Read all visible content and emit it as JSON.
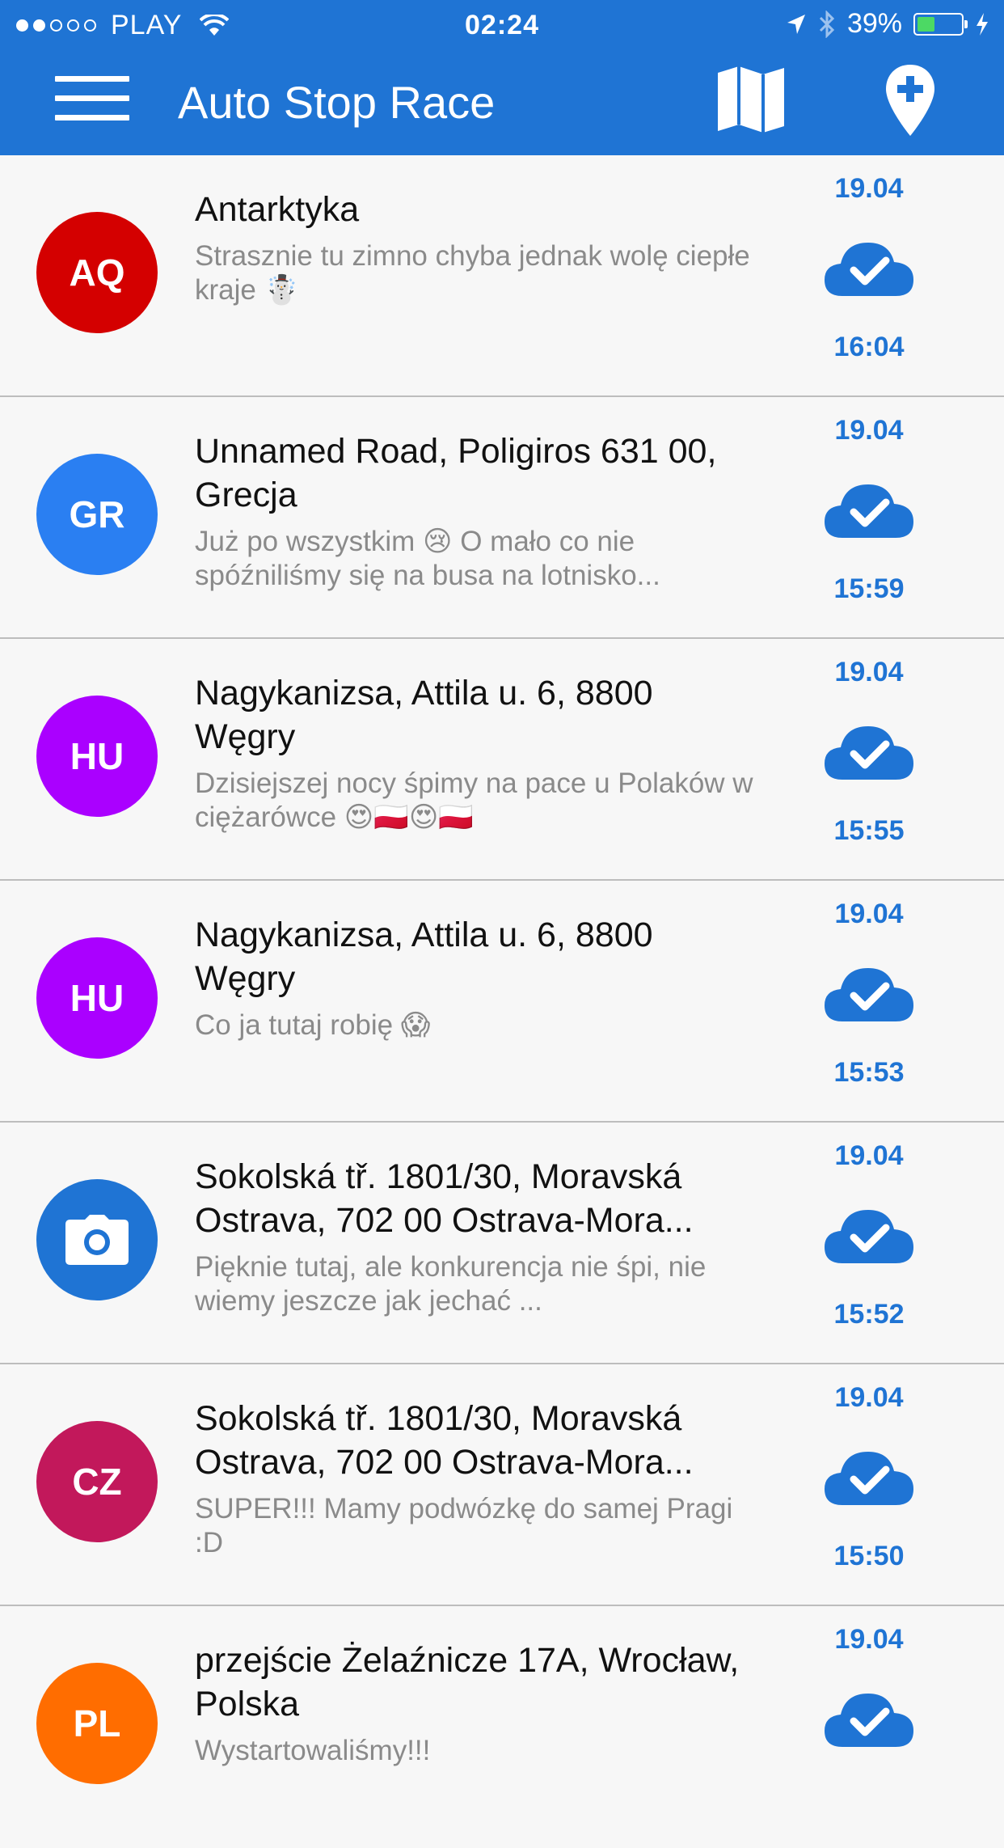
{
  "status_bar": {
    "carrier": "PLAY",
    "time": "02:24",
    "battery": "39%",
    "signal_bars_filled": 2,
    "signal_bars_total": 5
  },
  "header": {
    "title": "Auto Stop Race",
    "icons": [
      "menu-icon",
      "map-icon",
      "add-location-icon"
    ]
  },
  "colors": {
    "brand_blue": "#1f74d4",
    "divider": "#bdbdbd",
    "battery_green": "#4cd964"
  },
  "posts": [
    {
      "avatar": "AQ",
      "avatar_color": "#d40000",
      "title": "Antarktyka",
      "message": "Strasznie tu zimno chyba jednak wolę ciepłe kraje ☃️",
      "date": "19.04",
      "time": "16:04",
      "status_icon": "cloud-check-icon"
    },
    {
      "avatar": "GR",
      "avatar_color": "#2a7ff2",
      "title": "Unnamed Road, Poligiros 631 00, Grecja",
      "message": "Już po wszystkim 😢 O mało co nie spóźniliśmy się na busa na lotnisko...",
      "date": "19.04",
      "time": "15:59",
      "status_icon": "cloud-check-icon"
    },
    {
      "avatar": "HU",
      "avatar_color": "#aa00ff",
      "title": "Nagykanizsa, Attila u. 6, 8800 Węgry",
      "message": "Dzisiejszej nocy śpimy na pace u Polaków w ciężarówce 😍🇵🇱😍🇵🇱",
      "date": "19.04",
      "time": "15:55",
      "status_icon": "cloud-check-icon"
    },
    {
      "avatar": "HU",
      "avatar_color": "#aa00ff",
      "title": "Nagykanizsa, Attila u. 6, 8800 Węgry",
      "message": "Co ja tutaj robię 😱",
      "date": "19.04",
      "time": "15:53",
      "status_icon": "cloud-check-icon"
    },
    {
      "avatar": "",
      "avatar_icon": "camera-icon",
      "avatar_color": "#1f74d4",
      "title": "Sokolská tř. 1801/30, Moravská Ostrava, 702 00 Ostrava-Mora...",
      "message": "Pięknie tutaj, ale konkurencja nie śpi, nie wiemy jeszcze jak jechać ...",
      "date": "19.04",
      "time": "15:52",
      "status_icon": "cloud-check-icon"
    },
    {
      "avatar": "CZ",
      "avatar_color": "#c2185b",
      "title": "Sokolská tř. 1801/30, Moravská Ostrava, 702 00 Ostrava-Mora...",
      "message": "SUPER!!! Mamy podwózkę do samej Pragi :D",
      "date": "19.04",
      "time": "15:50",
      "status_icon": "cloud-check-icon"
    },
    {
      "avatar": "PL",
      "avatar_color": "#ff6d00",
      "title": "przejście Żelaźnicze 17A, Wrocław, Polska",
      "message": "Wystartowaliśmy!!!",
      "date": "19.04",
      "time": "",
      "status_icon": "cloud-check-icon"
    }
  ]
}
